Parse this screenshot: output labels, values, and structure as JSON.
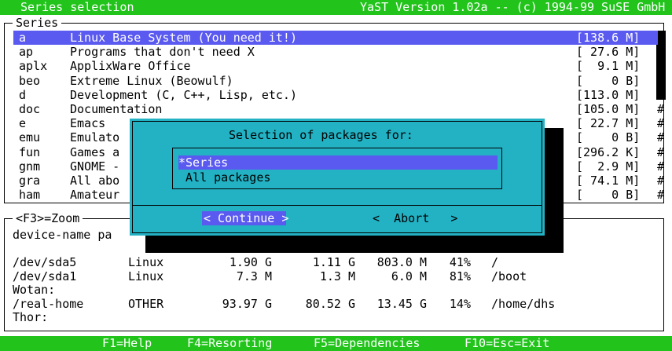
{
  "topbar": {
    "title": "Series selection",
    "version": "YaST Version 1.02a -- (c) 1994-99 SuSE GmbH"
  },
  "series_box": {
    "label": "Series",
    "rows": [
      {
        "code": "a",
        "desc": "Linux Base System (You need it!)",
        "size": "[138.6 M]",
        "mark": ""
      },
      {
        "code": "ap",
        "desc": "Programs that don't need X",
        "size": "[ 27.6 M]",
        "mark": ""
      },
      {
        "code": "aplx",
        "desc": "ApplixWare Office",
        "size": "[  9.1 M]",
        "mark": ""
      },
      {
        "code": "beo",
        "desc": "Extreme Linux (Beowulf)",
        "size": "[    0 B]",
        "mark": ""
      },
      {
        "code": "d",
        "desc": "Development (C, C++, Lisp, etc.)",
        "size": "[113.0 M]",
        "mark": "#"
      },
      {
        "code": "doc",
        "desc": "Documentation",
        "size": "[105.0 M]",
        "mark": "#"
      },
      {
        "code": "e",
        "desc": "Emacs",
        "size": "[ 22.7 M]",
        "mark": "#"
      },
      {
        "code": "emu",
        "desc": "Emulato",
        "size": "[    0 B]",
        "mark": "#"
      },
      {
        "code": "fun",
        "desc": "Games a",
        "size": "[296.2 K]",
        "mark": "#"
      },
      {
        "code": "gnm",
        "desc": "GNOME -",
        "size": "[  2.9 M]",
        "mark": "#"
      },
      {
        "code": "gra",
        "desc": "All abo",
        "size": "[ 74.1 M]",
        "mark": "#"
      },
      {
        "code": "ham",
        "desc": "Amateur",
        "size": "[    0 B]",
        "mark": "#"
      }
    ]
  },
  "zoom_box": {
    "label": "<F3>=Zoom",
    "header": "device-name pa",
    "rows": [
      {
        "dev": "/dev/sda5",
        "type": "Linux",
        "size": "1.90 G",
        "used": "1.11 G",
        "free": "803.0 M",
        "pct": "41%",
        "mount": "/"
      },
      {
        "dev": "/dev/sda1",
        "type": "Linux",
        "size": "7.3 M",
        "used": "1.3 M",
        "free": "6.0 M",
        "pct": "81%",
        "mount": "/boot"
      },
      {
        "dev": "Wotan:",
        "type": "",
        "size": "",
        "used": "",
        "free": "",
        "pct": "",
        "mount": ""
      },
      {
        "dev": "/real-home",
        "type": "OTHER",
        "size": "93.97 G",
        "used": "80.52 G",
        "free": "13.45 G",
        "pct": "14%",
        "mount": "/home/dhs"
      },
      {
        "dev": "Thor:",
        "type": "",
        "size": "",
        "used": "",
        "free": "",
        "pct": "",
        "mount": ""
      }
    ]
  },
  "dialog": {
    "title": "Selection of packages for:",
    "options": [
      "*Series",
      " All packages"
    ],
    "continue_label": "< Continue >",
    "abort_label": "<  Abort   >"
  },
  "bottombar": {
    "keys": [
      "F1=Help",
      "F4=Resorting",
      "F5=Dependencies",
      "F10=Esc=Exit"
    ]
  },
  "colors": {
    "green": "#22c41c",
    "select_blue": "#5a5af0",
    "dialog_cyan": "#22b2c4"
  }
}
